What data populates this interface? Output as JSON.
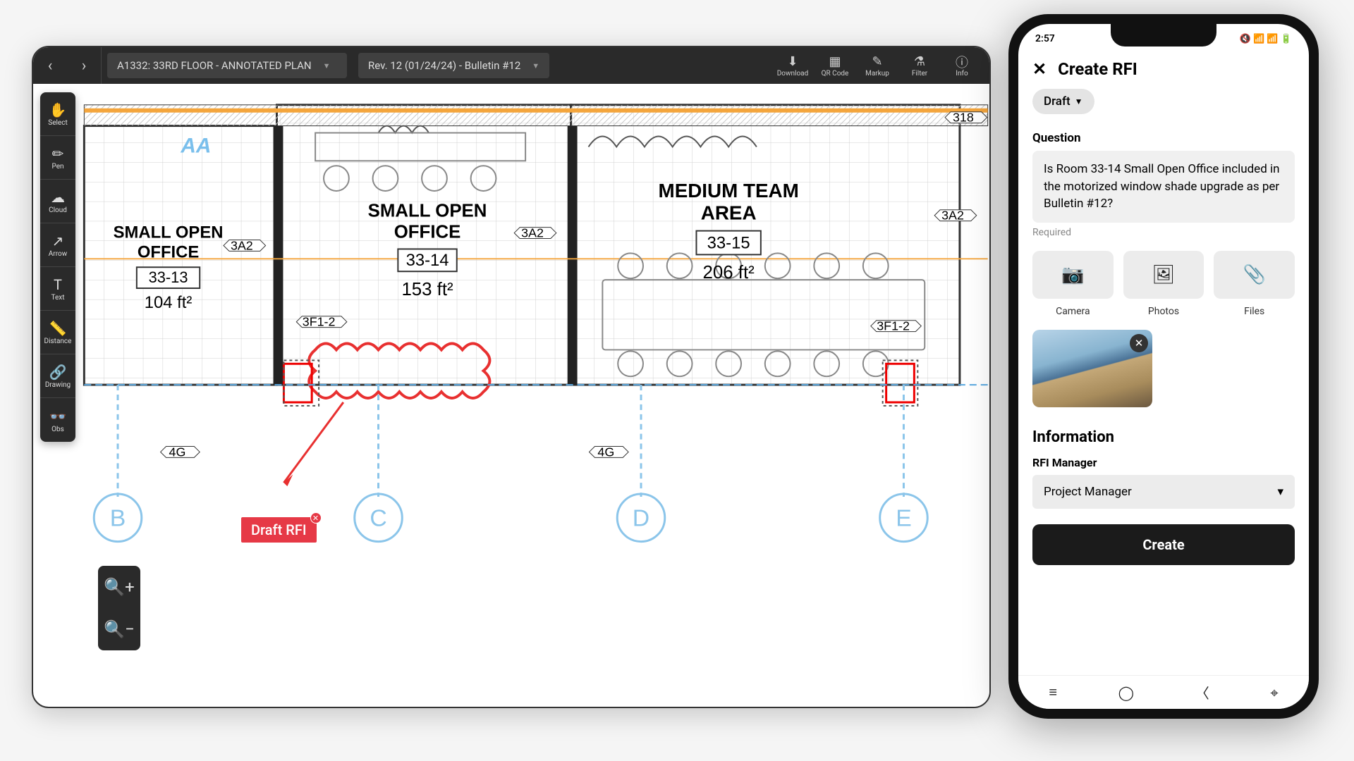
{
  "topbar": {
    "sheet_dropdown": "A1332: 33RD FLOOR - ANNOTATED PLAN",
    "revision_dropdown": "Rev. 12 (01/24/24) - Bulletin #12",
    "actions": {
      "download": "Download",
      "qrcode": "QR Code",
      "markup": "Markup",
      "filter": "Filter",
      "info": "Info"
    }
  },
  "tools": {
    "select": "Select",
    "pen": "Pen",
    "cloud": "Cloud",
    "arrow": "Arrow",
    "text": "Text",
    "distance": "Distance",
    "drawing": "Drawing",
    "obs": "Obs"
  },
  "plan": {
    "rooms": [
      {
        "name": "SMALL OPEN OFFICE",
        "number": "33-13",
        "area": "104 ft²"
      },
      {
        "name": "SMALL OPEN OFFICE",
        "number": "33-14",
        "area": "153 ft²"
      },
      {
        "name": "MEDIUM TEAM AREA",
        "number": "33-15",
        "area": "206 ft²"
      }
    ],
    "tags": {
      "t3A2": "3A2",
      "t318": "318",
      "t3F12": "3F1-2",
      "t4G": "4G",
      "tAA": "AA"
    },
    "grids": [
      "B",
      "C",
      "D",
      "E"
    ],
    "draft_tag": "Draft RFI"
  },
  "phone": {
    "time": "2:57",
    "title": "Create RFI",
    "status_chip": "Draft",
    "question_label": "Question",
    "question_text": "Is Room 33-14 Small Open Office included in the motorized window shade upgrade as per Bulletin #12?",
    "required": "Required",
    "attach": {
      "camera": "Camera",
      "photos": "Photos",
      "files": "Files"
    },
    "info_section": "Information",
    "manager_label": "RFI Manager",
    "manager_value": "Project Manager",
    "create_button": "Create"
  }
}
